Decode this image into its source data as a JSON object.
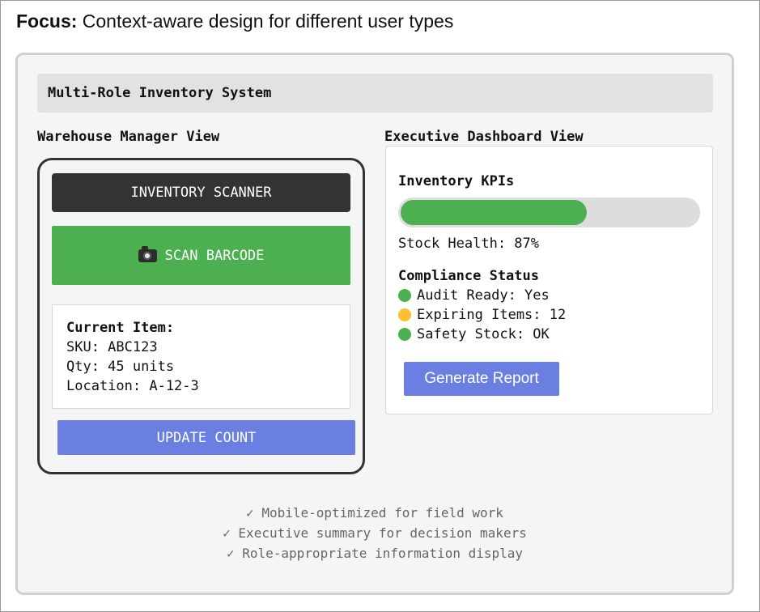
{
  "heading": {
    "bold": "Focus:",
    "text": " Context-aware design for different user types"
  },
  "system_title": "Multi-Role Inventory System",
  "manager": {
    "label": "Warehouse Manager View",
    "header": "INVENTORY SCANNER",
    "scan_label": "SCAN BARCODE",
    "scan_icon": "camera-icon",
    "item": {
      "title": "Current Item:",
      "sku": "SKU: ABC123",
      "qty": "Qty: 45 units",
      "location": "Location: A-12-3"
    },
    "update_label": "UPDATE COUNT"
  },
  "executive": {
    "label": "Executive Dashboard View",
    "kpi_title": "Inventory KPIs",
    "stock_health_percent": 87,
    "stock_health_label": "Stock Health: 87%",
    "compliance_title": "Compliance Status",
    "statuses": [
      {
        "text": "Audit Ready: Yes",
        "color": "#4caf50"
      },
      {
        "text": "Expiring Items: 12",
        "color": "#fbc02d"
      },
      {
        "text": "Safety Stock: OK",
        "color": "#4caf50"
      }
    ],
    "report_label": "Generate Report"
  },
  "notes": [
    "✓ Mobile-optimized for field work",
    "✓ Executive summary for decision makers",
    "✓ Role-appropriate information display"
  ],
  "colors": {
    "green": "#4caf50",
    "blue": "#6b7fe3",
    "dark": "#333333"
  }
}
